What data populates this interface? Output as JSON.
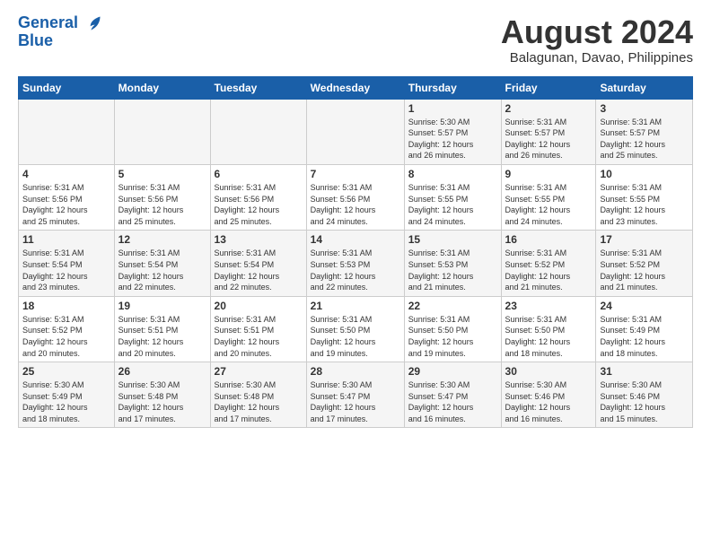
{
  "logo": {
    "line1": "General",
    "line2": "Blue"
  },
  "header": {
    "month": "August 2024",
    "location": "Balagunan, Davao, Philippines"
  },
  "weekdays": [
    "Sunday",
    "Monday",
    "Tuesday",
    "Wednesday",
    "Thursday",
    "Friday",
    "Saturday"
  ],
  "weeks": [
    [
      {
        "day": "",
        "info": ""
      },
      {
        "day": "",
        "info": ""
      },
      {
        "day": "",
        "info": ""
      },
      {
        "day": "",
        "info": ""
      },
      {
        "day": "1",
        "info": "Sunrise: 5:30 AM\nSunset: 5:57 PM\nDaylight: 12 hours\nand 26 minutes."
      },
      {
        "day": "2",
        "info": "Sunrise: 5:31 AM\nSunset: 5:57 PM\nDaylight: 12 hours\nand 26 minutes."
      },
      {
        "day": "3",
        "info": "Sunrise: 5:31 AM\nSunset: 5:57 PM\nDaylight: 12 hours\nand 25 minutes."
      }
    ],
    [
      {
        "day": "4",
        "info": "Sunrise: 5:31 AM\nSunset: 5:56 PM\nDaylight: 12 hours\nand 25 minutes."
      },
      {
        "day": "5",
        "info": "Sunrise: 5:31 AM\nSunset: 5:56 PM\nDaylight: 12 hours\nand 25 minutes."
      },
      {
        "day": "6",
        "info": "Sunrise: 5:31 AM\nSunset: 5:56 PM\nDaylight: 12 hours\nand 25 minutes."
      },
      {
        "day": "7",
        "info": "Sunrise: 5:31 AM\nSunset: 5:56 PM\nDaylight: 12 hours\nand 24 minutes."
      },
      {
        "day": "8",
        "info": "Sunrise: 5:31 AM\nSunset: 5:55 PM\nDaylight: 12 hours\nand 24 minutes."
      },
      {
        "day": "9",
        "info": "Sunrise: 5:31 AM\nSunset: 5:55 PM\nDaylight: 12 hours\nand 24 minutes."
      },
      {
        "day": "10",
        "info": "Sunrise: 5:31 AM\nSunset: 5:55 PM\nDaylight: 12 hours\nand 23 minutes."
      }
    ],
    [
      {
        "day": "11",
        "info": "Sunrise: 5:31 AM\nSunset: 5:54 PM\nDaylight: 12 hours\nand 23 minutes."
      },
      {
        "day": "12",
        "info": "Sunrise: 5:31 AM\nSunset: 5:54 PM\nDaylight: 12 hours\nand 22 minutes."
      },
      {
        "day": "13",
        "info": "Sunrise: 5:31 AM\nSunset: 5:54 PM\nDaylight: 12 hours\nand 22 minutes."
      },
      {
        "day": "14",
        "info": "Sunrise: 5:31 AM\nSunset: 5:53 PM\nDaylight: 12 hours\nand 22 minutes."
      },
      {
        "day": "15",
        "info": "Sunrise: 5:31 AM\nSunset: 5:53 PM\nDaylight: 12 hours\nand 21 minutes."
      },
      {
        "day": "16",
        "info": "Sunrise: 5:31 AM\nSunset: 5:52 PM\nDaylight: 12 hours\nand 21 minutes."
      },
      {
        "day": "17",
        "info": "Sunrise: 5:31 AM\nSunset: 5:52 PM\nDaylight: 12 hours\nand 21 minutes."
      }
    ],
    [
      {
        "day": "18",
        "info": "Sunrise: 5:31 AM\nSunset: 5:52 PM\nDaylight: 12 hours\nand 20 minutes."
      },
      {
        "day": "19",
        "info": "Sunrise: 5:31 AM\nSunset: 5:51 PM\nDaylight: 12 hours\nand 20 minutes."
      },
      {
        "day": "20",
        "info": "Sunrise: 5:31 AM\nSunset: 5:51 PM\nDaylight: 12 hours\nand 20 minutes."
      },
      {
        "day": "21",
        "info": "Sunrise: 5:31 AM\nSunset: 5:50 PM\nDaylight: 12 hours\nand 19 minutes."
      },
      {
        "day": "22",
        "info": "Sunrise: 5:31 AM\nSunset: 5:50 PM\nDaylight: 12 hours\nand 19 minutes."
      },
      {
        "day": "23",
        "info": "Sunrise: 5:31 AM\nSunset: 5:50 PM\nDaylight: 12 hours\nand 18 minutes."
      },
      {
        "day": "24",
        "info": "Sunrise: 5:31 AM\nSunset: 5:49 PM\nDaylight: 12 hours\nand 18 minutes."
      }
    ],
    [
      {
        "day": "25",
        "info": "Sunrise: 5:30 AM\nSunset: 5:49 PM\nDaylight: 12 hours\nand 18 minutes."
      },
      {
        "day": "26",
        "info": "Sunrise: 5:30 AM\nSunset: 5:48 PM\nDaylight: 12 hours\nand 17 minutes."
      },
      {
        "day": "27",
        "info": "Sunrise: 5:30 AM\nSunset: 5:48 PM\nDaylight: 12 hours\nand 17 minutes."
      },
      {
        "day": "28",
        "info": "Sunrise: 5:30 AM\nSunset: 5:47 PM\nDaylight: 12 hours\nand 17 minutes."
      },
      {
        "day": "29",
        "info": "Sunrise: 5:30 AM\nSunset: 5:47 PM\nDaylight: 12 hours\nand 16 minutes."
      },
      {
        "day": "30",
        "info": "Sunrise: 5:30 AM\nSunset: 5:46 PM\nDaylight: 12 hours\nand 16 minutes."
      },
      {
        "day": "31",
        "info": "Sunrise: 5:30 AM\nSunset: 5:46 PM\nDaylight: 12 hours\nand 15 minutes."
      }
    ]
  ]
}
